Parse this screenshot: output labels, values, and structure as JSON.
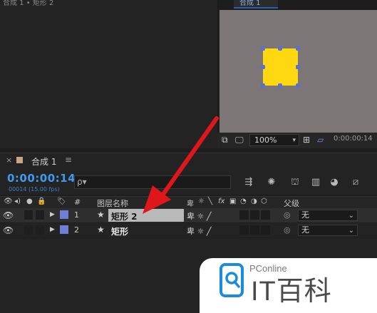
{
  "top_left": {
    "tab_title": "合成 1 • 矩形 2"
  },
  "viewer": {
    "tab_title": "合成 1",
    "zoom": "100%",
    "timecode": "0:00:00:14",
    "shape_color": "#ffd811"
  },
  "timeline": {
    "comp_tab": "合成 1",
    "close_glyph": "×",
    "menu_glyph": "≡",
    "timecode": "0:00:00:14",
    "fps": "00014 (15.00 fps)",
    "search_glyph": "ρ▾",
    "columns": {
      "hash": "#",
      "layer_name": "图层名称",
      "parent": "父级"
    },
    "layers": [
      {
        "index": "1",
        "name": "矩形 2",
        "label_color": "#6f7fd4",
        "parent": "无",
        "selected": true
      },
      {
        "index": "2",
        "name": "矩形",
        "label_color": "#6f7fd4",
        "parent": "无",
        "selected": false
      }
    ]
  },
  "watermark": {
    "brand": "PConline",
    "title": "IT百科"
  }
}
